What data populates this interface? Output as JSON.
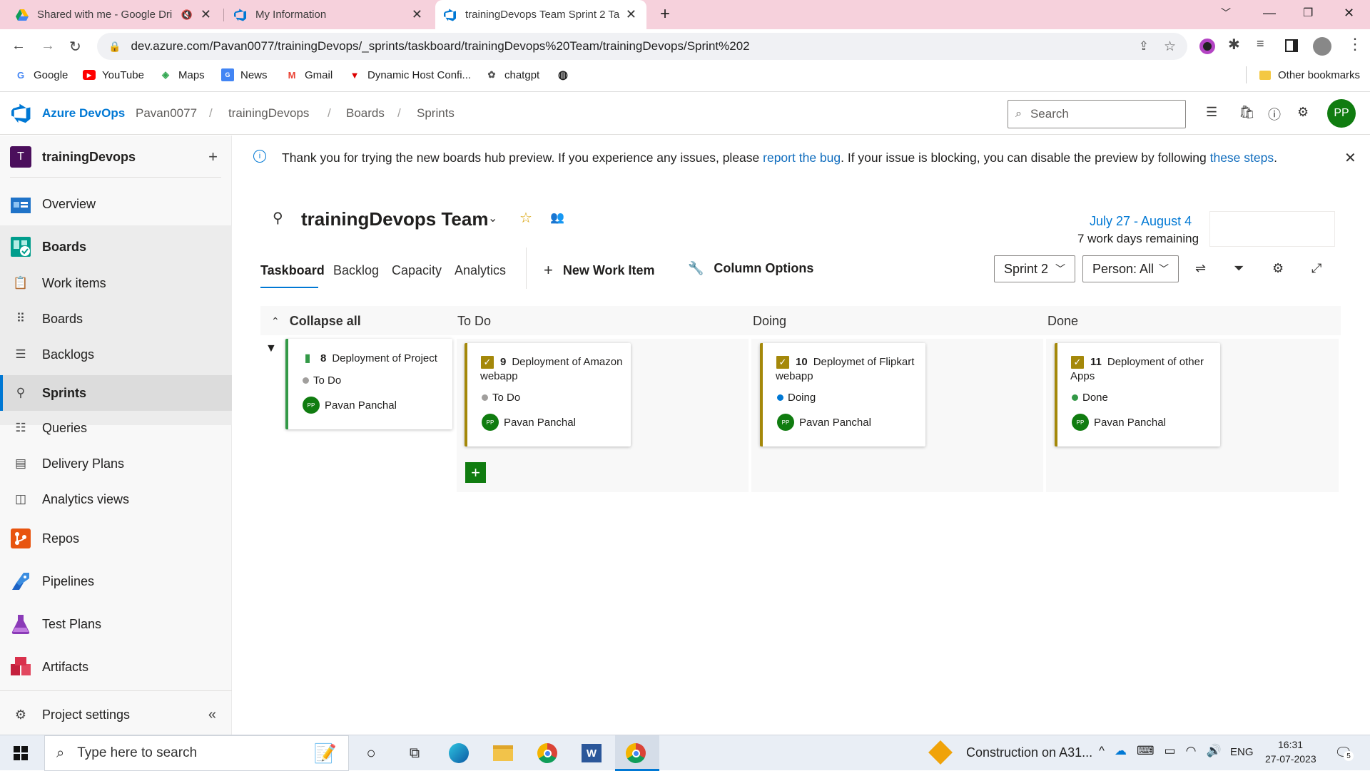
{
  "browser": {
    "tabs": [
      {
        "title": "Shared with me - Google Dri"
      },
      {
        "title": "My Information"
      },
      {
        "title": "trainingDevops Team Sprint 2 Ta"
      }
    ],
    "url": "dev.azure.com/Pavan0077/trainingDevops/_sprints/taskboard/trainingDevops%20Team/trainingDevops/Sprint%202",
    "bookmarks": [
      "Google",
      "YouTube",
      "Maps",
      "News",
      "Gmail",
      "Dynamic Host Confi...",
      "chatgpt"
    ],
    "other_bookmarks": "Other bookmarks"
  },
  "header": {
    "brand": "Azure DevOps",
    "breadcrumbs": [
      "Pavan0077",
      "trainingDevops",
      "Boards",
      "Sprints"
    ],
    "search_placeholder": "Search",
    "avatar": "PP"
  },
  "sidebar": {
    "project_initial": "T",
    "project": "trainingDevops",
    "items": [
      {
        "label": "Overview"
      },
      {
        "label": "Boards"
      },
      {
        "label": "Work items"
      },
      {
        "label": "Boards"
      },
      {
        "label": "Backlogs"
      },
      {
        "label": "Sprints"
      },
      {
        "label": "Queries"
      },
      {
        "label": "Delivery Plans"
      },
      {
        "label": "Analytics views"
      },
      {
        "label": "Repos"
      },
      {
        "label": "Pipelines"
      },
      {
        "label": "Test Plans"
      },
      {
        "label": "Artifacts"
      }
    ],
    "settings": "Project settings"
  },
  "banner": {
    "text1": "Thank you for trying the new boards hub preview. If you experience any issues, please ",
    "link1": "report the bug",
    "text2": ". If your issue is blocking, you can disable the preview by following ",
    "link2": "these steps",
    "text3": "."
  },
  "team": {
    "name": "trainingDevops Team",
    "dates": "July 27 - August 4",
    "remaining": "7 work days remaining"
  },
  "pivots": [
    "Taskboard",
    "Backlog",
    "Capacity",
    "Analytics"
  ],
  "toolbar": {
    "new_item": "New Work Item",
    "column_options": "Column Options",
    "sprint": "Sprint 2",
    "person": "Person: All"
  },
  "board": {
    "collapse_all": "Collapse all",
    "columns": [
      "To Do",
      "Doing",
      "Done"
    ],
    "parent": {
      "id": "8",
      "title": "Deployment of Project",
      "state": "To Do",
      "owner": "Pavan Panchal",
      "owner_initials": "PP"
    },
    "cards": [
      {
        "id": "9",
        "title": "Deployment of Amazon webapp",
        "state": "To Do",
        "owner": "Pavan Panchal",
        "owner_initials": "PP"
      },
      {
        "id": "10",
        "title": "Deploymet of Flipkart webapp",
        "state": "Doing",
        "owner": "Pavan Panchal",
        "owner_initials": "PP"
      },
      {
        "id": "11",
        "title": "Deployment of other Apps",
        "state": "Done",
        "owner": "Pavan Panchal",
        "owner_initials": "PP"
      }
    ],
    "state_colors": {
      "To Do": "#a19f9d",
      "Doing": "#0078d4",
      "Done": "#339947"
    }
  },
  "taskbar": {
    "search": "Type here to search",
    "news": "Construction on A31...",
    "lang": "ENG",
    "time": "16:31",
    "date": "27-07-2023",
    "notif": "5"
  }
}
